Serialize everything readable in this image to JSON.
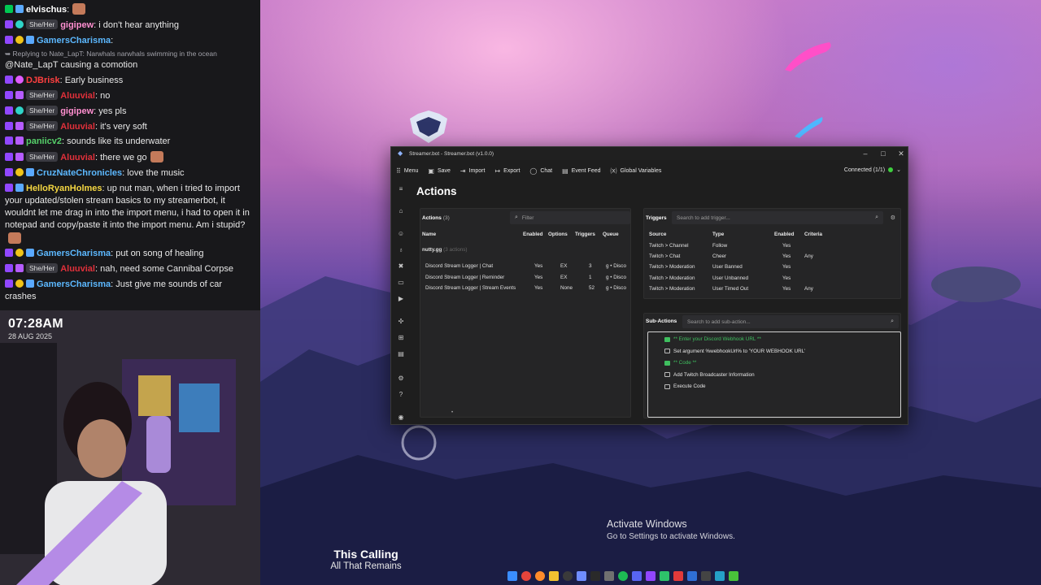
{
  "chat": {
    "messages": [
      {
        "user": "elvischus",
        "color": "#ffffff",
        "text": ":",
        "badges": [
          "green",
          "blue"
        ],
        "emote": true
      },
      {
        "user": "gigipew",
        "color": "#ff8fd0",
        "pronoun": "She/Her",
        "text": ": i don't hear anything",
        "badges": [
          "purple",
          "teal"
        ]
      },
      {
        "user": "GamersCharisma",
        "color": "#5cb8ff",
        "text": ":",
        "badges": [
          "purple",
          "yellow",
          "blue"
        ]
      },
      {
        "reply": "➥ Replying to Nate_LapT: Narwhals narwhals swimming in the ocean",
        "text": "@Nate_LapT causing a comotion"
      },
      {
        "user": "DJBrisk",
        "color": "#ff4040",
        "text": ": Early business",
        "badges": [
          "purple",
          "vip"
        ]
      },
      {
        "user": "Aluuvial",
        "color": "#e0303a",
        "pronoun": "She/Her",
        "text": ": no",
        "badges": [
          "purple",
          "gift"
        ]
      },
      {
        "user": "gigipew",
        "color": "#ff8fd0",
        "pronoun": "She/Her",
        "text": ": yes pls",
        "badges": [
          "purple",
          "teal"
        ]
      },
      {
        "user": "Aluuvial",
        "color": "#e0303a",
        "pronoun": "She/Her",
        "text": ": it's very soft",
        "badges": [
          "purple",
          "gift"
        ]
      },
      {
        "user": "paniicv2",
        "color": "#56d06a",
        "text": ": sounds like its underwater",
        "badges": [
          "purple",
          "gift"
        ]
      },
      {
        "user": "Aluuvial",
        "color": "#e0303a",
        "pronoun": "She/Her",
        "text": ": there we go",
        "badges": [
          "purple",
          "gift"
        ],
        "emote": true
      },
      {
        "user": "CruzNateChronicles",
        "color": "#5cb8ff",
        "text": ": love the music",
        "badges": [
          "purple",
          "yellow",
          "blue"
        ]
      },
      {
        "user": "HelloRyanHolmes",
        "color": "#f5d742",
        "text": ": up nut man, when i tried to import your updated/stolen stream basics to my streamerbot, it wouldnt let me drag in into the import menu, i had to open it in notepad and copy/paste it into the import menu. Am i stupid?",
        "badges": [
          "purple",
          "blue"
        ],
        "emote": true,
        "wrap": true
      },
      {
        "user": "GamersCharisma",
        "color": "#5cb8ff",
        "text": ": put on song of healing",
        "badges": [
          "purple",
          "yellow",
          "blue"
        ]
      },
      {
        "user": "Aluuvial",
        "color": "#e0303a",
        "pronoun": "She/Her",
        "text": ": nah, need some Cannibal Corpse",
        "badges": [
          "purple",
          "gift"
        ]
      },
      {
        "user": "GamersCharisma",
        "color": "#5cb8ff",
        "text": ": Just give me sounds of car crashes",
        "badges": [
          "purple",
          "yellow",
          "blue"
        ],
        "wrap": true
      }
    ]
  },
  "webcam": {
    "time": "07:28AM",
    "date": "28 AUG 2025"
  },
  "desktop": {
    "activate_title": "Activate Windows",
    "activate_sub": "Go to Settings to activate Windows.",
    "song_title": "This Calling",
    "song_artist": "All That Remains"
  },
  "window": {
    "title": "Streamer.bot - Streamer.bot (v1.0.0)",
    "menu": [
      {
        "icon": "grid-icon",
        "glyph": "⠿",
        "label": "Menu"
      },
      {
        "icon": "save-icon",
        "glyph": "▣",
        "label": "Save"
      },
      {
        "icon": "import-icon",
        "glyph": "⇥",
        "label": "Import"
      },
      {
        "icon": "export-icon",
        "glyph": "↦",
        "label": "Export"
      },
      {
        "icon": "chat-icon",
        "glyph": "◯",
        "label": "Chat"
      },
      {
        "icon": "event-feed-icon",
        "glyph": "▤",
        "label": "Event Feed"
      },
      {
        "icon": "variables-icon",
        "glyph": "⒳",
        "label": "Global Variables"
      }
    ],
    "connection": "Connected (1/1)",
    "heading": "Actions"
  },
  "actions": {
    "title": "Actions",
    "count": "(3)",
    "filter_placeholder": "Filter",
    "columns": [
      "Name",
      "Enabled",
      "Options",
      "Triggers",
      "Queue"
    ],
    "group": "nutty.gg",
    "group_count": "(3 actions)",
    "rows": [
      {
        "name": "Discord Stream Logger | Chat",
        "enabled": "Yes",
        "options": "EX",
        "triggers": "3",
        "queue": "g • Disco"
      },
      {
        "name": "Discord Stream Logger | Reminder",
        "enabled": "Yes",
        "options": "EX",
        "triggers": "1",
        "queue": "g • Disco"
      },
      {
        "name": "Discord Stream Logger | Stream Events",
        "enabled": "Yes",
        "options": "None",
        "triggers": "52",
        "queue": "g • Disco"
      }
    ]
  },
  "triggers": {
    "title": "Triggers",
    "search_placeholder": "Search to add trigger...",
    "columns": [
      "Source",
      "Type",
      "Enabled",
      "Criteria"
    ],
    "rows": [
      {
        "source": "Twitch > Channel",
        "type": "Follow",
        "enabled": "Yes",
        "criteria": ""
      },
      {
        "source": "Twitch > Chat",
        "type": "Cheer",
        "enabled": "Yes",
        "criteria": "Any"
      },
      {
        "source": "Twitch > Moderation",
        "type": "User Banned",
        "enabled": "Yes",
        "criteria": ""
      },
      {
        "source": "Twitch > Moderation",
        "type": "User Unbanned",
        "enabled": "Yes",
        "criteria": ""
      },
      {
        "source": "Twitch > Moderation",
        "type": "User Timed Out",
        "enabled": "Yes",
        "criteria": "Any"
      }
    ]
  },
  "subactions": {
    "title": "Sub-Actions",
    "search_placeholder": "Search to add sub-action...",
    "items": [
      {
        "label": "** Enter your Discord Webhook URL **",
        "comment": true
      },
      {
        "label": "Set argument %webhookUrl% to 'YOUR WEBHOOK URL'",
        "comment": false
      },
      {
        "label": "** Code **",
        "comment": true
      },
      {
        "label": "Add Twitch Broadcaster Information",
        "comment": false
      },
      {
        "label": "Execute Code",
        "comment": false
      }
    ]
  },
  "colors": {
    "accent_green": "#3ecf3e",
    "comment_green": "#3fbf5f",
    "window_bg": "#1e1e1e",
    "panel_bg": "#252526",
    "chat_bg": "#18181b"
  }
}
